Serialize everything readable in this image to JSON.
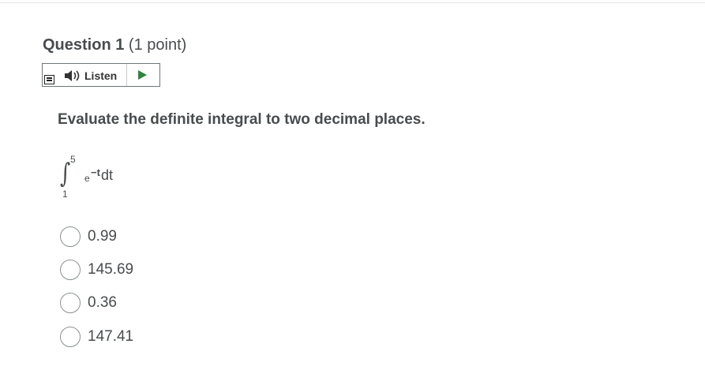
{
  "question": {
    "title": "Question 1",
    "points": "(1 point)"
  },
  "readspeaker": {
    "listen_label": "Listen",
    "menu_icon": "menu-icon",
    "speaker_icon": "speaker-icon",
    "play_icon": "play-icon",
    "play_color": "#2e8540"
  },
  "prompt": "Evaluate the definite integral to two decimal places.",
  "integral": {
    "sign": "∫",
    "upper_limit": "5",
    "lower_limit": "1",
    "base": "e",
    "exponent": "−t",
    "differential": "dt"
  },
  "choices": [
    {
      "label": "0.99",
      "selected": false
    },
    {
      "label": "145.69",
      "selected": false
    },
    {
      "label": "0.36",
      "selected": false
    },
    {
      "label": "147.41",
      "selected": false
    }
  ]
}
